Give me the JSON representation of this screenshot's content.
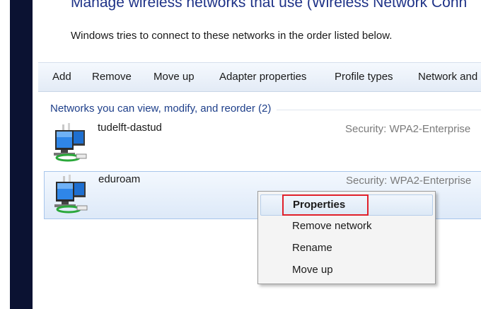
{
  "header": {
    "title": "Manage wireless networks that use (Wireless Network Conn",
    "subtitle": "Windows tries to connect to these networks in the order listed below."
  },
  "toolbar": {
    "items": [
      "Add",
      "Remove",
      "Move up",
      "Adapter properties",
      "Profile types",
      "Network and"
    ]
  },
  "group": {
    "label": "Networks you can view, modify, and reorder (2)"
  },
  "networks": [
    {
      "name": "tudelft-dastud",
      "security": "Security:  WPA2-Enterprise",
      "selected": false
    },
    {
      "name": "eduroam",
      "security": "Security:  WPA2-Enterprise",
      "selected": true
    }
  ],
  "context_menu": {
    "items": [
      "Properties",
      "Remove network",
      "Rename",
      "Move up"
    ],
    "highlighted_item": "Properties",
    "highlight_color": "#e0202a"
  },
  "icons": {
    "network": "wireless-network-monitor-icon"
  }
}
